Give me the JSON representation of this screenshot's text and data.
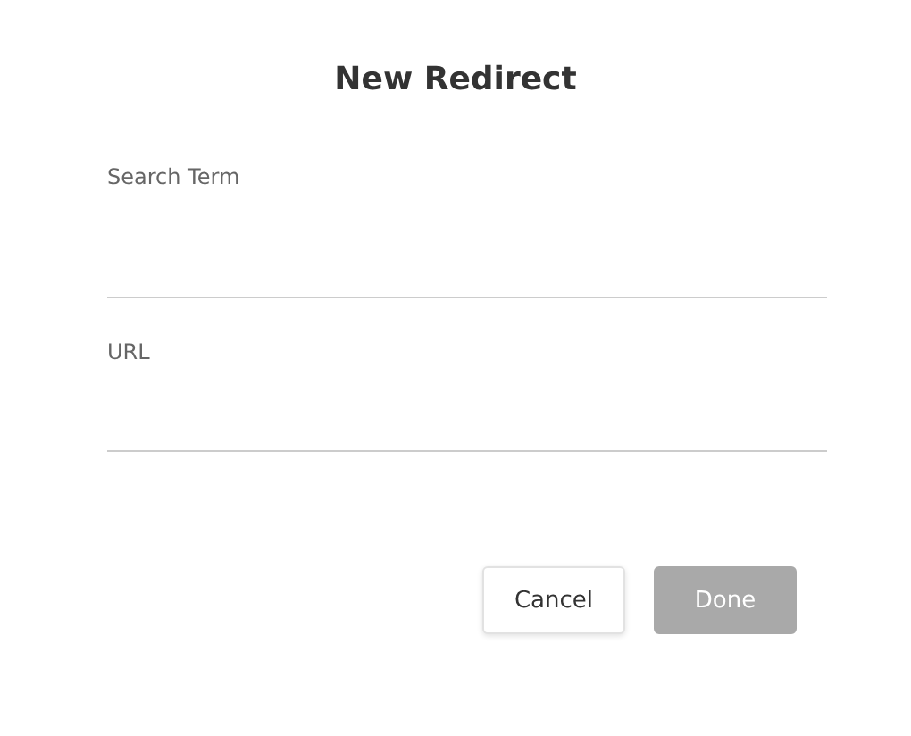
{
  "dialog": {
    "title": "New Redirect",
    "fields": [
      {
        "label": "Search Term"
      },
      {
        "label": "URL"
      }
    ],
    "buttons": [
      {
        "label": "Cancel",
        "disabled": false
      },
      {
        "label": "Done",
        "disabled": true
      }
    ]
  }
}
